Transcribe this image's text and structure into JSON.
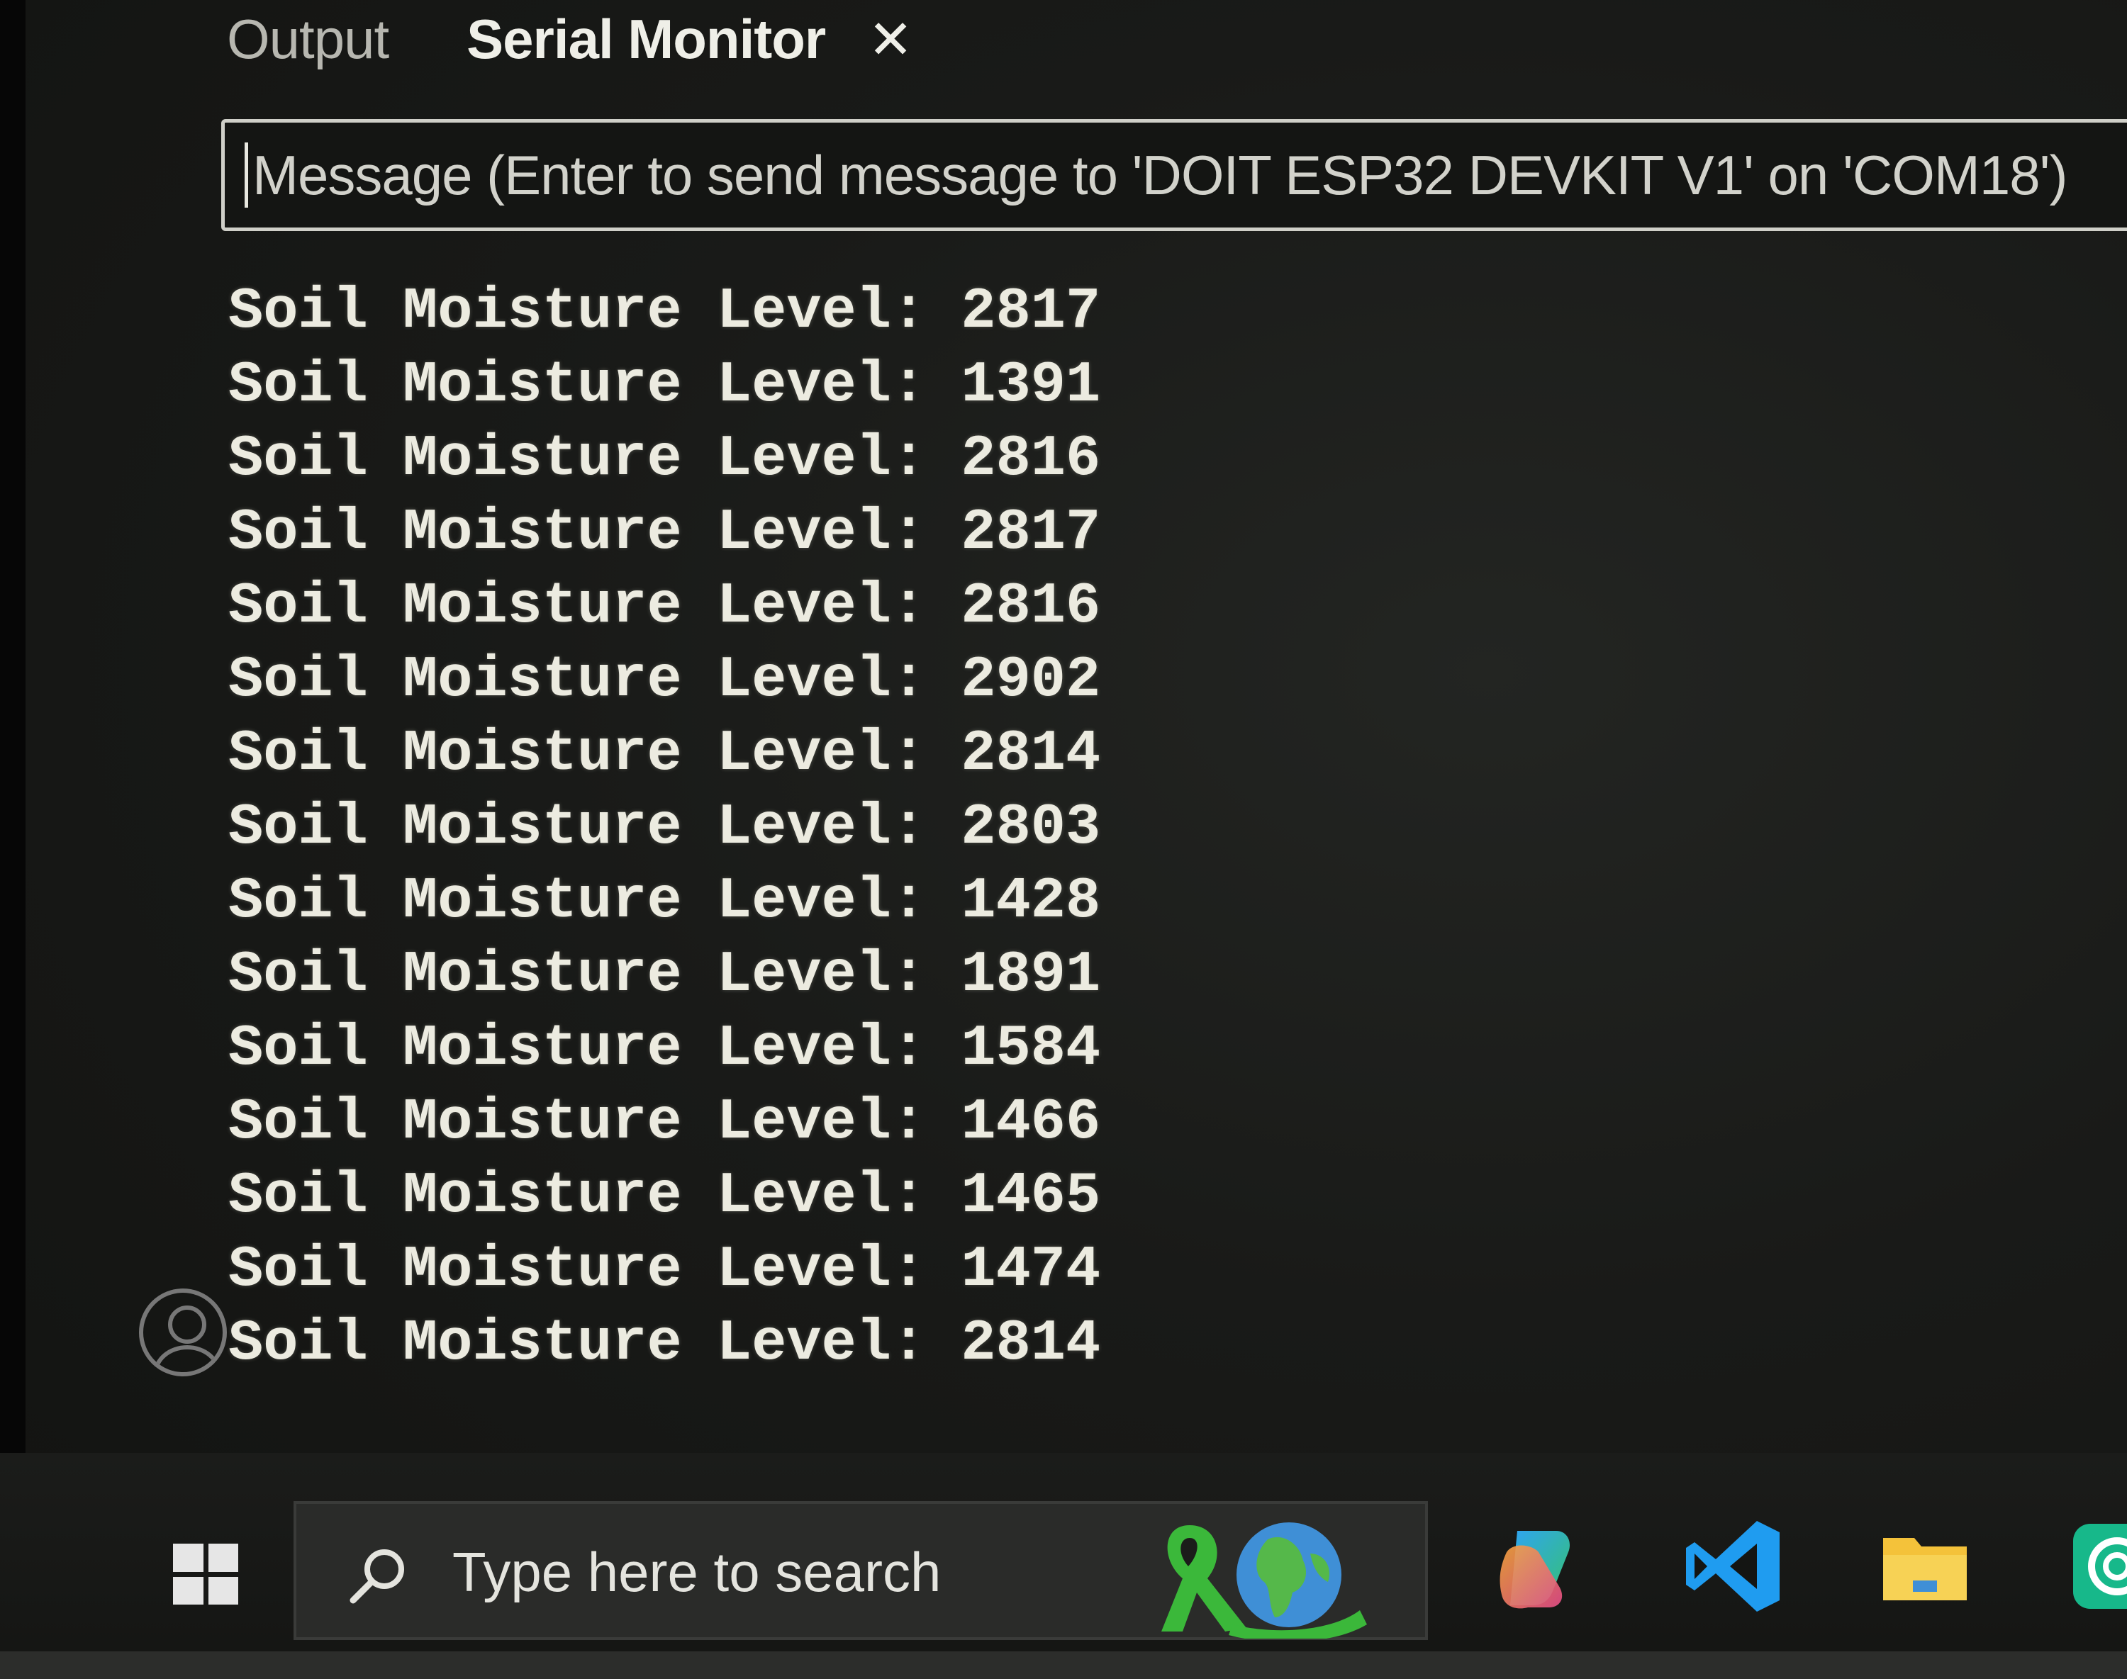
{
  "panel": {
    "tabs": [
      {
        "label": "Output",
        "active": false
      },
      {
        "label": "Serial Monitor",
        "active": true
      }
    ],
    "close_icon": "close-icon"
  },
  "message_input": {
    "placeholder": "Message (Enter to send message to 'DOIT ESP32 DEVKIT V1' on 'COM18')",
    "value": ""
  },
  "serial_output": {
    "lines": [
      "Soil Moisture Level: 2817",
      "Soil Moisture Level: 1391",
      "Soil Moisture Level: 2816",
      "Soil Moisture Level: 2817",
      "Soil Moisture Level: 2816",
      "Soil Moisture Level: 2902",
      "Soil Moisture Level: 2814",
      "Soil Moisture Level: 2803",
      "Soil Moisture Level: 1428",
      "Soil Moisture Level: 1891",
      "Soil Moisture Level: 1584",
      "Soil Moisture Level: 1466",
      "Soil Moisture Level: 1465",
      "Soil Moisture Level: 1474",
      "Soil Moisture Level: 2814"
    ]
  },
  "sidebar": {
    "account_icon": "account-icon"
  },
  "taskbar": {
    "start_icon": "windows-start-icon",
    "search_placeholder": "Type here to search",
    "search_icon": "search-icon",
    "search_highlight_icon": "awareness-ribbon-globe-icon",
    "pinned": [
      {
        "icon": "copilot-icon"
      },
      {
        "icon": "vscode-icon"
      },
      {
        "icon": "file-explorer-icon"
      },
      {
        "icon": "app-icon"
      }
    ]
  },
  "colors": {
    "background": "#191a18",
    "text": "#ecebe0",
    "input_border": "#cfcfc8",
    "vscode_blue": "#1f9cf0",
    "folder_yellow": "#f4c23a"
  }
}
